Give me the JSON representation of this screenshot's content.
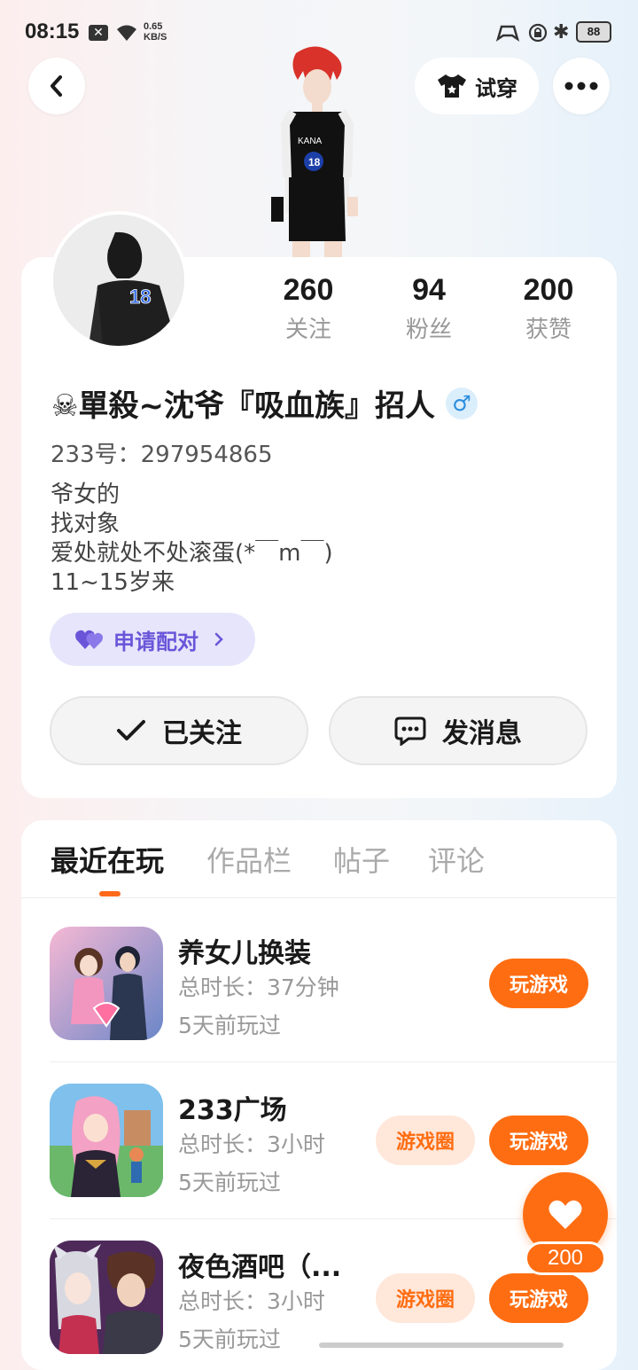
{
  "status_bar": {
    "time": "08:15",
    "speed_value": "0.65",
    "speed_unit": "KB/S",
    "battery": "88"
  },
  "header": {
    "try_on_label": "试穿"
  },
  "profile": {
    "stats": [
      {
        "value": "260",
        "label": "关注"
      },
      {
        "value": "94",
        "label": "粉丝"
      },
      {
        "value": "200",
        "label": "获赞"
      }
    ],
    "name": "☠單殺~沈爷『吸血族』招人",
    "gender_symbol": "♂",
    "uid": "233号：297954865",
    "bio": [
      "爷女的",
      "找对象",
      "爱处就处不处滚蛋(*￣m￣)",
      "11~15岁来"
    ],
    "pair_label": "申请配对",
    "followed_label": "已关注",
    "message_label": "发消息"
  },
  "tabs": [
    "最近在玩",
    "作品栏",
    "帖子",
    "评论"
  ],
  "games": [
    {
      "name": "养女儿换装",
      "duration": "总时长：37分钟",
      "last_played": "5天前玩过",
      "play_label": "玩游戏",
      "circle_label": ""
    },
    {
      "name": "233广场",
      "duration": "总时长：3小时",
      "last_played": "5天前玩过",
      "play_label": "玩游戏",
      "circle_label": "游戏圈"
    },
    {
      "name": "夜色酒吧（...",
      "duration": "总时长：3小时",
      "last_played": "5天前玩过",
      "play_label": "玩游戏",
      "circle_label": "游戏圈"
    }
  ],
  "like_count": "200",
  "colors": {
    "accent": "#ff6d12",
    "pair": "#6a55d9",
    "gender": "#2b8de0"
  }
}
